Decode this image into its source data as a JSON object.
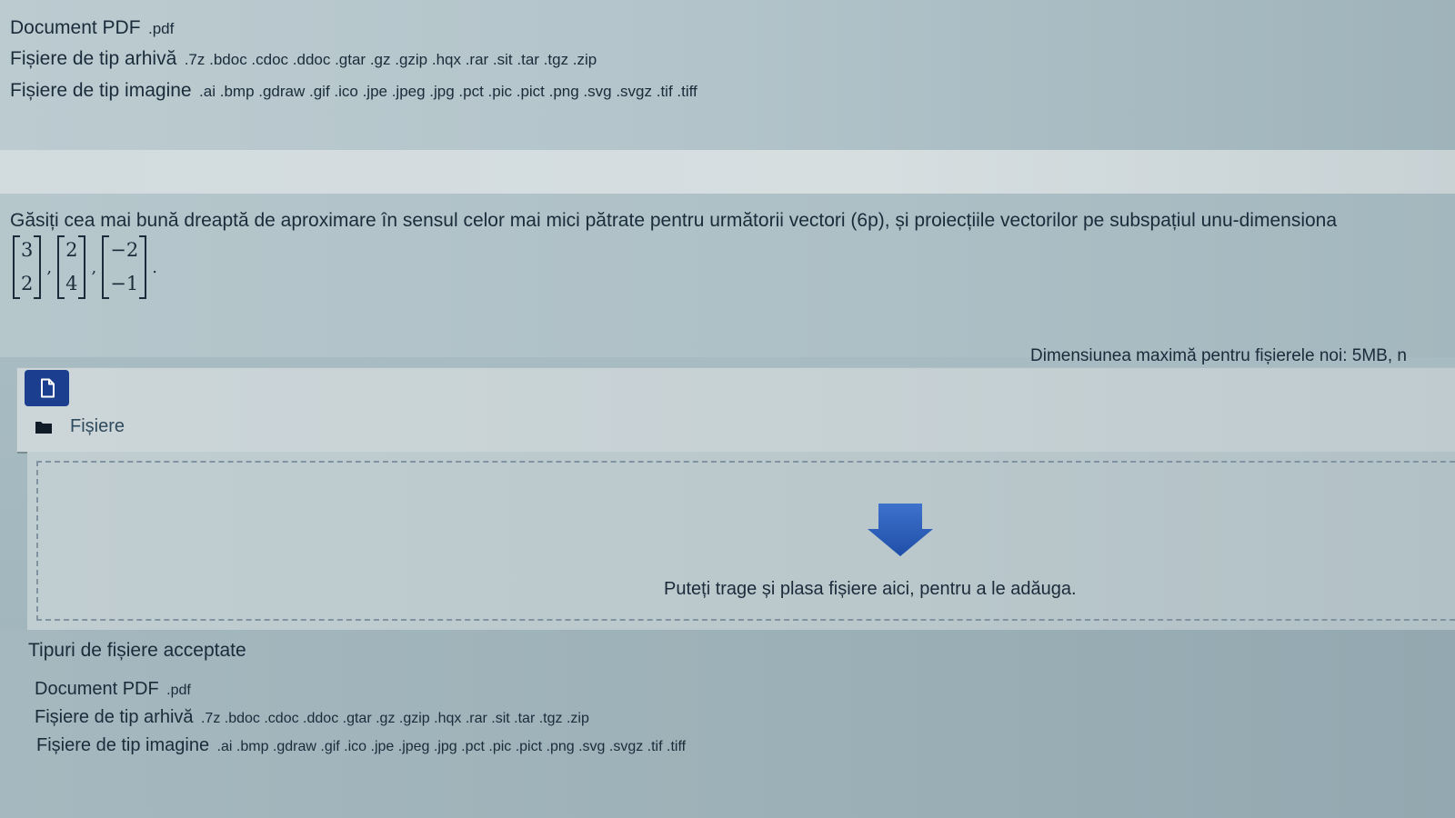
{
  "top_list": {
    "pdf": {
      "label": "Document PDF",
      "exts": ".pdf"
    },
    "archive": {
      "label": "Fișiere de tip arhivă",
      "exts": ".7z .bdoc .cdoc .ddoc .gtar .gz .gzip .hqx .rar .sit .tar .tgz .zip"
    },
    "image": {
      "label": "Fișiere de tip imagine",
      "exts": ".ai .bmp .gdraw .gif .ico .jpe .jpeg .jpg .pct .pic .pict .png .svg .svgz .tif .tiff"
    }
  },
  "question": {
    "text": "Găsiți cea mai bună dreaptă de aproximare în sensul celor mai mici pătrate pentru următorii vectori (6p), și proiecțiile vectorilor pe subspațiul unu-dimensiona",
    "vectors": [
      {
        "top": "3",
        "bottom": "2"
      },
      {
        "top": "2",
        "bottom": "4"
      },
      {
        "top": "−2",
        "bottom": "−1"
      }
    ],
    "separator": ",",
    "terminator": "."
  },
  "upload": {
    "max_size_text": "Dimensiunea maximă pentru fișierele noi: 5MB, n",
    "file_button_icon": "file-icon",
    "folder_icon": "folder-icon",
    "folder_label": "Fișiere",
    "drop_icon": "download-arrow-icon",
    "drop_text": "Puteți trage și plasa fișiere aici, pentru a le adăuga."
  },
  "accepted": {
    "title": "Tipuri de fișiere acceptate",
    "pdf": {
      "label": "Document PDF",
      "exts": ".pdf"
    },
    "archive": {
      "label": "Fișiere de tip arhivă",
      "exts": ".7z .bdoc .cdoc .ddoc .gtar .gz .gzip .hqx .rar .sit .tar .tgz .zip"
    },
    "image": {
      "label": "Fișiere de tip imagine",
      "exts": ".ai .bmp .gdraw .gif .ico .jpe .jpeg .jpg .pct .pic .pict .png .svg .svgz .tif .tiff"
    }
  },
  "colors": {
    "primary_button": "#1b3f8e",
    "drop_arrow": "#2f5fb8",
    "text": "#1b2b3a"
  }
}
